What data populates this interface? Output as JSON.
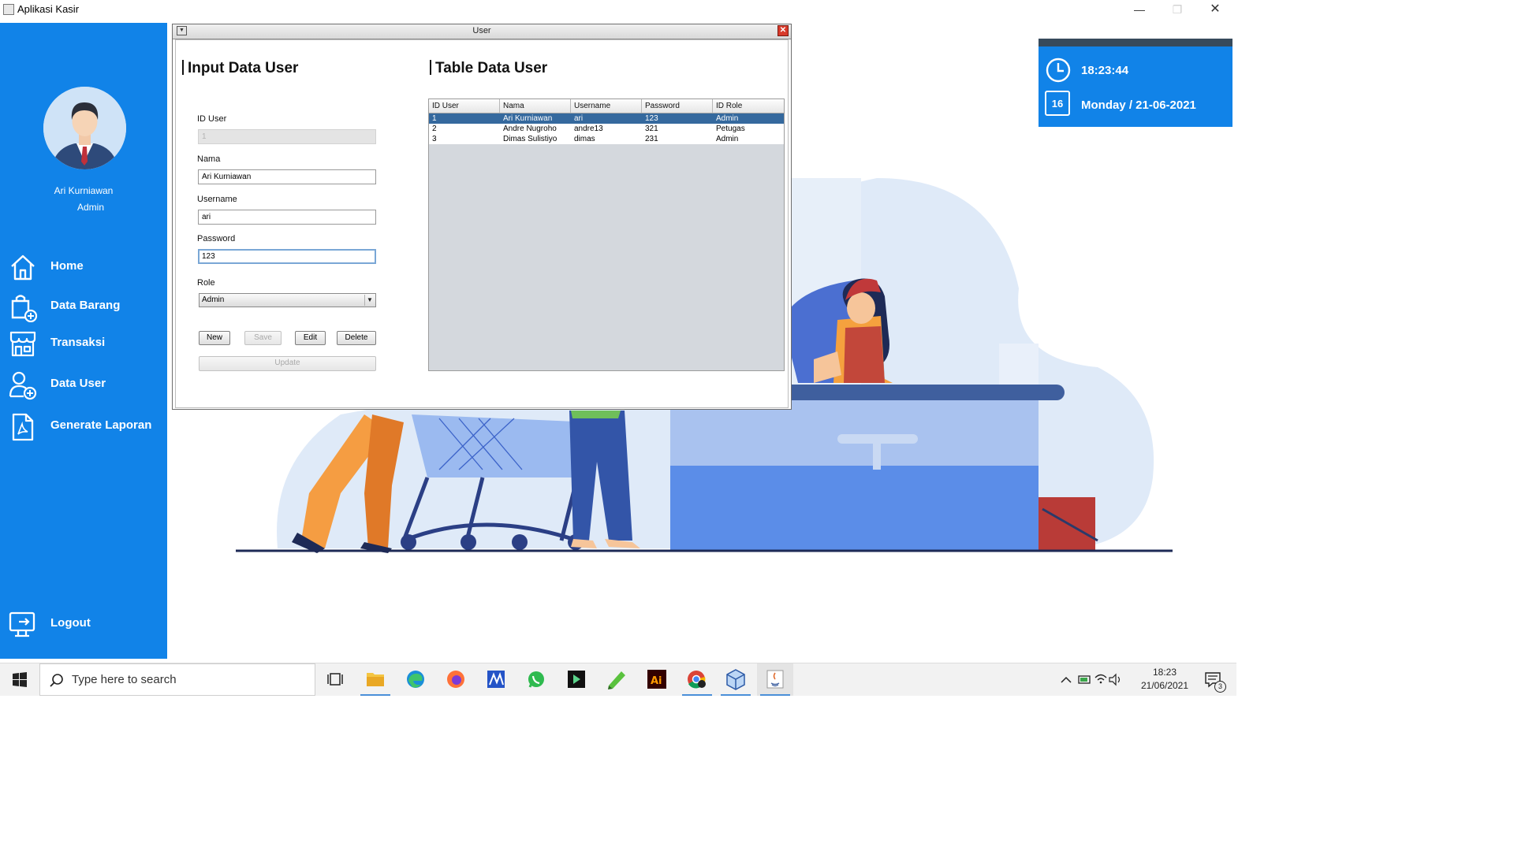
{
  "window": {
    "title": "Aplikasi Kasir",
    "controls": [
      "minimize-icon",
      "maximize-icon",
      "close-icon"
    ]
  },
  "sidebar": {
    "user_name": "Ari Kurniawan",
    "user_role": "Admin",
    "menu": [
      {
        "label": "Home",
        "icon": "home-icon"
      },
      {
        "label": "Data Barang",
        "icon": "shopping-bag-add-icon"
      },
      {
        "label": "Transaksi",
        "icon": "store-icon"
      },
      {
        "label": "Data User",
        "icon": "user-add-icon"
      },
      {
        "label": "Generate Laporan",
        "icon": "pdf-document-icon"
      }
    ],
    "logout": "Logout"
  },
  "clock": {
    "time": "18:23:44",
    "date": "Monday / 21-06-2021",
    "calendar_day": "16"
  },
  "dialog": {
    "title": "User",
    "input_section_title": "Input Data User",
    "table_section_title": "Table Data User",
    "form": {
      "id_label": "ID User",
      "id_value": "1",
      "nama_label": "Nama",
      "nama_value": "Ari Kurniawan",
      "username_label": "Username",
      "username_value": "ari",
      "password_label": "Password",
      "password_value": "123",
      "role_label": "Role",
      "role_value": "Admin"
    },
    "buttons": {
      "new": "New",
      "save": "Save",
      "edit": "Edit",
      "delete": "Delete",
      "update": "Update"
    },
    "table": {
      "columns": [
        "ID User",
        "Nama",
        "Username",
        "Password",
        "ID Role"
      ],
      "rows": [
        [
          "1",
          "Ari Kurniawan",
          "ari",
          "123",
          "Admin"
        ],
        [
          "2",
          "Andre Nugroho",
          "andre13",
          "321",
          "Petugas"
        ],
        [
          "3",
          "Dimas Sulistiyo",
          "dimas",
          "231",
          "Admin"
        ]
      ],
      "selected_row": 0
    }
  },
  "taskbar": {
    "search_placeholder": "Type here to search",
    "apps": [
      "task-view-icon",
      "file-explorer-icon",
      "edge-icon",
      "firefox-icon",
      "app-m-icon",
      "whatsapp-icon",
      "app-arrow-icon",
      "notepad-plus-icon",
      "illustrator-icon",
      "chrome-icon",
      "virtualbox-icon",
      "java-icon"
    ],
    "clock_time": "18:23",
    "clock_date": "21/06/2021",
    "notification_count": "3"
  },
  "colors": {
    "sidebar": "#1183e8",
    "selected_row": "#35699e",
    "clock_topbar": "#374a5c"
  }
}
